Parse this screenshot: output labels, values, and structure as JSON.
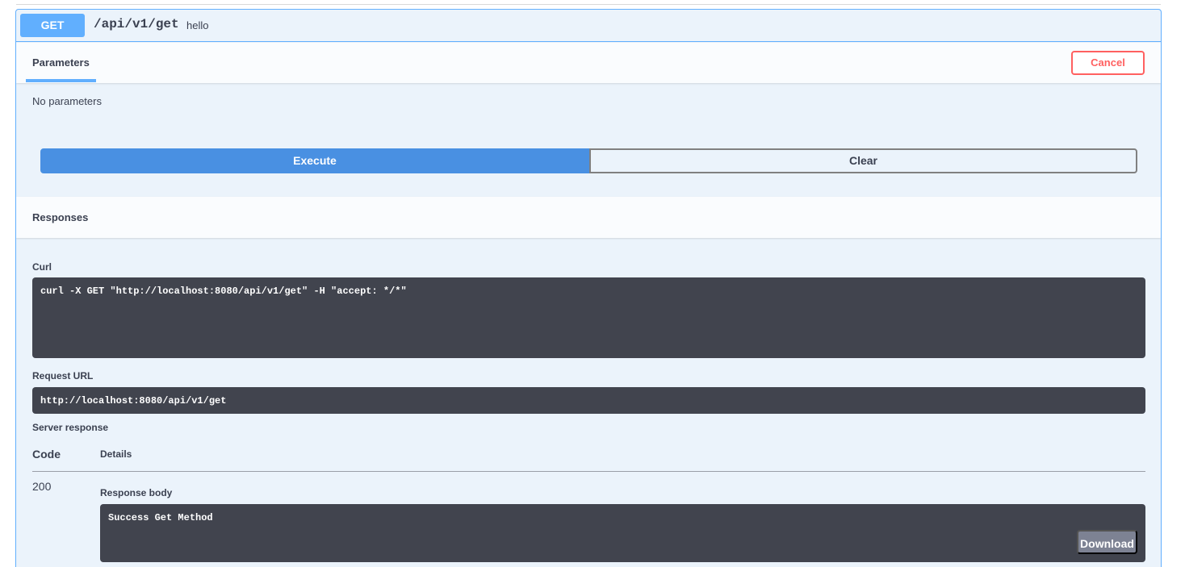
{
  "operation": {
    "method": "GET",
    "path": "/api/v1/get",
    "summary": "hello",
    "colors": {
      "get": "#61affe",
      "execute": "#4990e2",
      "cancel": "#ff6060"
    }
  },
  "parameters": {
    "tab_label": "Parameters",
    "cancel_label": "Cancel",
    "empty_text": "No parameters"
  },
  "actions": {
    "execute_label": "Execute",
    "clear_label": "Clear"
  },
  "responses": {
    "title": "Responses",
    "curl_label": "Curl",
    "curl_command": "curl -X GET \"http://localhost:8080/api/v1/get\" -H \"accept: */*\"",
    "request_url_label": "Request URL",
    "request_url": "http://localhost:8080/api/v1/get",
    "server_response_label": "Server response",
    "table_headers": {
      "code": "Code",
      "details": "Details"
    },
    "status_code": "200",
    "response_body_label": "Response body",
    "response_body": "Success Get Method",
    "download_label": "Download"
  }
}
